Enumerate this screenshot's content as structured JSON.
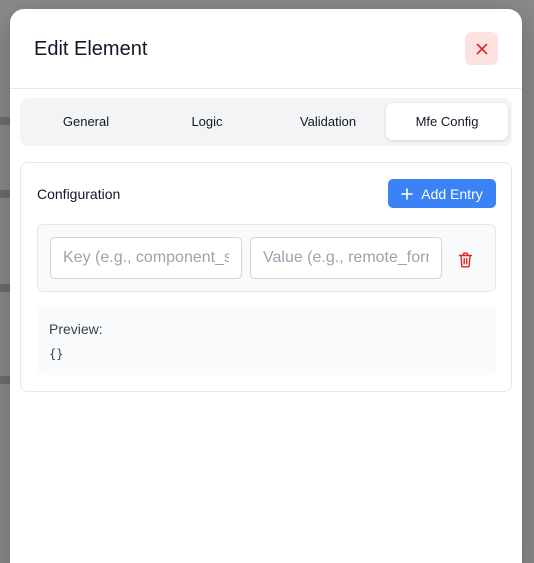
{
  "modal": {
    "title": "Edit Element"
  },
  "tabs": [
    {
      "label": "General",
      "active": false
    },
    {
      "label": "Logic",
      "active": false
    },
    {
      "label": "Validation",
      "active": false
    },
    {
      "label": "Mfe Config",
      "active": true
    }
  ],
  "config": {
    "title": "Configuration",
    "add_entry_label": "Add Entry",
    "entries": [
      {
        "key_value": "",
        "key_placeholder": "Key (e.g., component_s",
        "value_value": "",
        "value_placeholder": "Value (e.g., remote_forr"
      }
    ],
    "preview_label": "Preview:",
    "preview_value": "{}"
  },
  "colors": {
    "accent": "#3b82f6",
    "danger": "#dc2626",
    "close_bg": "#fee2e2"
  },
  "icons": {
    "close": "close-icon",
    "add": "plus-icon",
    "delete": "trash-icon"
  }
}
